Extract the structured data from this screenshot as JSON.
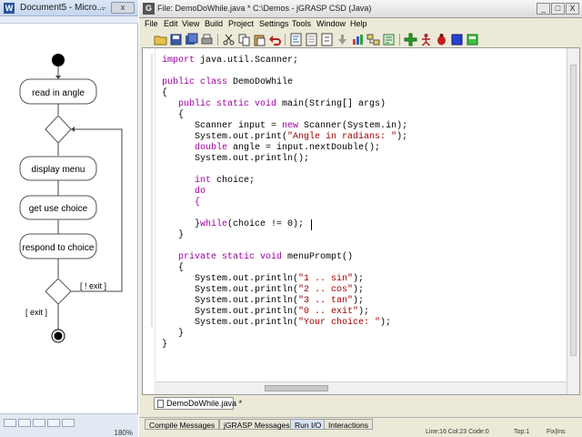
{
  "word": {
    "title": "Document5 - Micro...",
    "min_label": "–",
    "close_label": "x",
    "zoom": "180%",
    "diagram": {
      "read_in_angle": "read in angle",
      "display_menu": "display menu",
      "get_use_choice": "get use choice",
      "respond_to_choice": "respond to choice",
      "not_exit_guard": "[ ! exit ]",
      "exit_guard": "[ exit ]"
    }
  },
  "jgrasp": {
    "title": "File: DemoDoWhile.java *   C:\\Demos - jGRASP CSD (Java)",
    "window_buttons": {
      "minimize": "_",
      "maximize": "□",
      "close": "X"
    },
    "menu": [
      "File",
      "Edit",
      "View",
      "Build",
      "Project",
      "Settings",
      "Tools",
      "Window",
      "Help"
    ],
    "code": {
      "l1": "import java.util.Scanner;",
      "l2a": "public class",
      "l2b": " DemoDoWhile",
      "l3": "{",
      "l4a": "   public static void",
      "l4b": " main(String[] args)",
      "l5": "   {",
      "l6a": "      Scanner input = ",
      "l6b": "new",
      "l6c": " Scanner(System.in);",
      "l7a": "      System.out.print(",
      "l7b": "\"Angle in radians: \"",
      "l7c": ");",
      "l8a": "      double",
      "l8b": " angle = input.nextDouble();",
      "l9": "      System.out.println();",
      "l10a": "      int",
      "l10b": " choice;",
      "l11": "      do",
      "l12": "      {",
      "l13a": "      }",
      "l13b": "while",
      "l13c": "(choice != 0);",
      "l14": "   }",
      "l15a": "   private static void",
      "l15b": " menuPrompt()",
      "l16": "   {",
      "l17a": "      System.out.println(",
      "l17b": "\"1 .. sin\"",
      "l17c": ");",
      "l18a": "      System.out.println(",
      "l18b": "\"2 .. cos\"",
      "l18c": ");",
      "l19a": "      System.out.println(",
      "l19b": "\"3 .. tan\"",
      "l19c": ");",
      "l20a": "      System.out.println(",
      "l20b": "\"0 .. exit\"",
      "l20c": ");",
      "l21a": "      System.out.println(",
      "l21b": "\"Your choice: \"",
      "l21c": ");",
      "l22": "   }",
      "l23": "}"
    },
    "file_tab": "DemoDoWhile.java *",
    "message_tabs": [
      "Compile Messages",
      "jGRASP Messages",
      "Run I/O",
      "Interactions"
    ],
    "status": {
      "position": "Line:16   Col:23   Code:0",
      "top": "Top:1",
      "mode": "Fix|Ins"
    }
  },
  "colors": {
    "keyword": "#a000a0",
    "string": "#a00000",
    "window_bg": "#ece9d8"
  }
}
